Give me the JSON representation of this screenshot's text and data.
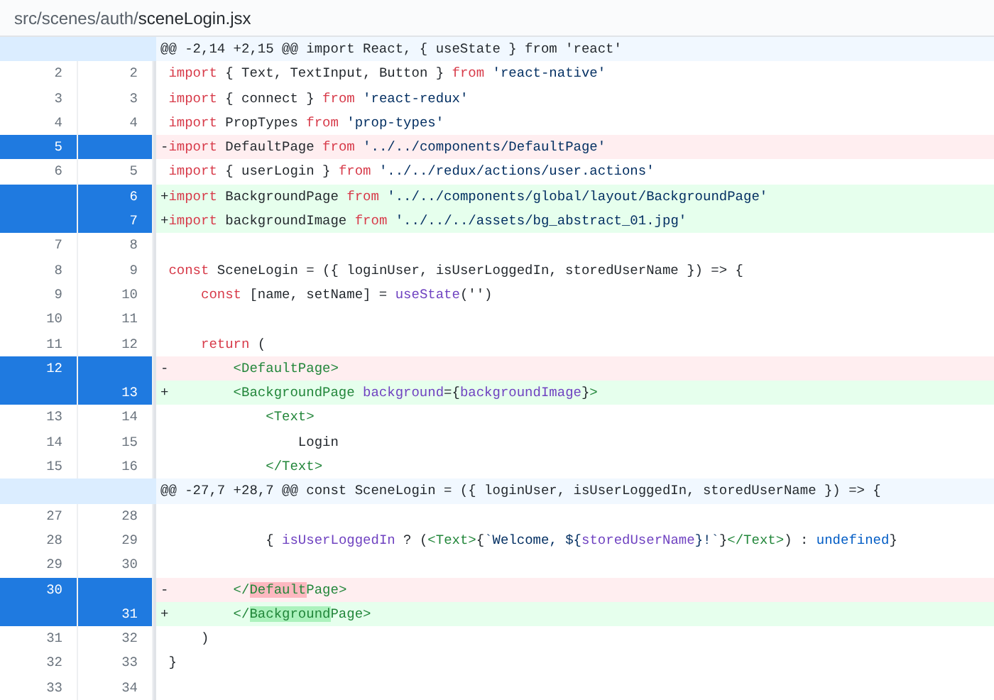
{
  "file_header": {
    "directory": "src/scenes/auth/",
    "filename": "sceneLogin.jsx"
  },
  "rows": [
    {
      "kind": "hunk",
      "text": "@@ -2,14 +2,15 @@ import React, { useState } from 'react'"
    },
    {
      "kind": "context",
      "old": "2",
      "new": "2",
      "selected": false,
      "tokens": [
        {
          "kind": "keyword",
          "text": "import"
        },
        {
          "kind": "plain",
          "text": " { Text, TextInput, Button } "
        },
        {
          "kind": "keyword",
          "text": "from"
        },
        {
          "kind": "string",
          "text": " 'react-native'"
        }
      ]
    },
    {
      "kind": "context",
      "old": "3",
      "new": "3",
      "selected": false,
      "tokens": [
        {
          "kind": "keyword",
          "text": "import"
        },
        {
          "kind": "plain",
          "text": " { connect } "
        },
        {
          "kind": "keyword",
          "text": "from"
        },
        {
          "kind": "string",
          "text": " 'react-redux'"
        }
      ]
    },
    {
      "kind": "context",
      "old": "4",
      "new": "4",
      "selected": false,
      "tokens": [
        {
          "kind": "keyword",
          "text": "import"
        },
        {
          "kind": "plain",
          "text": " PropTypes "
        },
        {
          "kind": "keyword",
          "text": "from"
        },
        {
          "kind": "string",
          "text": " 'prop-types'"
        }
      ]
    },
    {
      "kind": "deletion",
      "old": "5",
      "selected": true,
      "sign": "-",
      "tokens": [
        {
          "kind": "keyword",
          "text": "import"
        },
        {
          "kind": "plain",
          "text": " DefaultPage "
        },
        {
          "kind": "keyword",
          "text": "from"
        },
        {
          "kind": "string",
          "text": " '../../components/DefaultPage'"
        }
      ]
    },
    {
      "kind": "context",
      "old": "6",
      "new": "5",
      "selected": false,
      "tokens": [
        {
          "kind": "keyword",
          "text": "import"
        },
        {
          "kind": "plain",
          "text": " { userLogin } "
        },
        {
          "kind": "keyword",
          "text": "from"
        },
        {
          "kind": "string",
          "text": " '../../redux/actions/user.actions'"
        }
      ]
    },
    {
      "kind": "addition",
      "new": "6",
      "selected": true,
      "sign": "+",
      "tokens": [
        {
          "kind": "keyword",
          "text": "import"
        },
        {
          "kind": "plain",
          "text": " BackgroundPage "
        },
        {
          "kind": "keyword",
          "text": "from"
        },
        {
          "kind": "string",
          "text": " '../../components/global/layout/BackgroundPage'"
        }
      ]
    },
    {
      "kind": "addition",
      "new": "7",
      "selected": true,
      "sign": "+",
      "tokens": [
        {
          "kind": "keyword",
          "text": "import"
        },
        {
          "kind": "plain",
          "text": " backgroundImage "
        },
        {
          "kind": "keyword",
          "text": "from"
        },
        {
          "kind": "string",
          "text": " '../../../assets/bg_abstract_01.jpg'"
        }
      ]
    },
    {
      "kind": "context",
      "old": "7",
      "new": "8",
      "selected": false
    },
    {
      "kind": "context",
      "old": "8",
      "new": "9",
      "selected": false,
      "tokens": [
        {
          "kind": "keyword",
          "text": "const"
        },
        {
          "kind": "plain",
          "text": " SceneLogin = ({ loginUser, isUserLoggedIn, storedUserName }) => {"
        }
      ]
    },
    {
      "kind": "context",
      "old": "9",
      "new": "10",
      "selected": false,
      "tokens": [
        {
          "kind": "keyword",
          "text": "    const"
        },
        {
          "kind": "plain",
          "text": " [name, setName] = "
        },
        {
          "kind": "entity",
          "text": "useState"
        },
        {
          "kind": "plain",
          "text": "('')"
        }
      ]
    },
    {
      "kind": "context",
      "old": "10",
      "new": "11",
      "selected": false
    },
    {
      "kind": "context",
      "old": "11",
      "new": "12",
      "selected": false,
      "tokens": [
        {
          "kind": "keyword",
          "text": "    return"
        },
        {
          "kind": "plain",
          "text": " ("
        }
      ]
    },
    {
      "kind": "deletion",
      "old": "12",
      "selected": true,
      "sign": "-",
      "tokens": [
        {
          "kind": "tag",
          "text": "        <DefaultPage>"
        }
      ]
    },
    {
      "kind": "addition",
      "new": "13",
      "selected": true,
      "sign": "+",
      "tokens": [
        {
          "kind": "tag",
          "text": "        <BackgroundPage"
        },
        {
          "kind": "entity",
          "text": " background"
        },
        {
          "kind": "plain",
          "text": "={"
        },
        {
          "kind": "entity",
          "text": "backgroundImage"
        },
        {
          "kind": "plain",
          "text": "}"
        },
        {
          "kind": "tag",
          "text": ">"
        }
      ]
    },
    {
      "kind": "context",
      "old": "13",
      "new": "14",
      "selected": false,
      "tokens": [
        {
          "kind": "tag",
          "text": "            <Text>"
        }
      ]
    },
    {
      "kind": "context",
      "old": "14",
      "new": "15",
      "selected": false,
      "tokens": [
        {
          "kind": "plain",
          "text": "                Login"
        }
      ]
    },
    {
      "kind": "context",
      "old": "15",
      "new": "16",
      "selected": false,
      "tokens": [
        {
          "kind": "tag",
          "text": "            </Text>"
        }
      ]
    },
    {
      "kind": "hunk",
      "text": "@@ -27,7 +28,7 @@ const SceneLogin = ({ loginUser, isUserLoggedIn, storedUserName }) => {"
    },
    {
      "kind": "context",
      "old": "27",
      "new": "28",
      "selected": false
    },
    {
      "kind": "context",
      "old": "28",
      "new": "29",
      "selected": false,
      "tokens": [
        {
          "kind": "plain",
          "text": "            { "
        },
        {
          "kind": "entity",
          "text": "isUserLoggedIn"
        },
        {
          "kind": "plain",
          "text": " ? ("
        },
        {
          "kind": "tag",
          "text": "<Text>"
        },
        {
          "kind": "plain",
          "text": "{"
        },
        {
          "kind": "string",
          "text": "`Welcome, ${"
        },
        {
          "kind": "entity",
          "text": "storedUserName"
        },
        {
          "kind": "string",
          "text": "}!`"
        },
        {
          "kind": "plain",
          "text": "}"
        },
        {
          "kind": "tag",
          "text": "</Text>"
        },
        {
          "kind": "plain",
          "text": ") : "
        },
        {
          "kind": "constant",
          "text": "undefined"
        },
        {
          "kind": "plain",
          "text": "}"
        }
      ]
    },
    {
      "kind": "context",
      "old": "29",
      "new": "30",
      "selected": false
    },
    {
      "kind": "deletion",
      "old": "30",
      "selected": true,
      "sign": "-",
      "tokens": [
        {
          "kind": "tag",
          "text": "        </"
        },
        {
          "kind": "changed-tag",
          "text": "Default"
        },
        {
          "kind": "tag",
          "text": "Page>"
        }
      ]
    },
    {
      "kind": "addition",
      "new": "31",
      "selected": true,
      "sign": "+",
      "tokens": [
        {
          "kind": "tag",
          "text": "        </"
        },
        {
          "kind": "changed-tag",
          "text": "Background"
        },
        {
          "kind": "tag",
          "text": "Page>"
        }
      ]
    },
    {
      "kind": "context",
      "old": "31",
      "new": "32",
      "selected": false,
      "tokens": [
        {
          "kind": "plain",
          "text": "    )"
        }
      ]
    },
    {
      "kind": "context",
      "old": "32",
      "new": "33",
      "selected": false,
      "tokens": [
        {
          "kind": "plain",
          "text": "}"
        }
      ]
    },
    {
      "kind": "context",
      "old": "33",
      "new": "34",
      "selected": false
    }
  ]
}
